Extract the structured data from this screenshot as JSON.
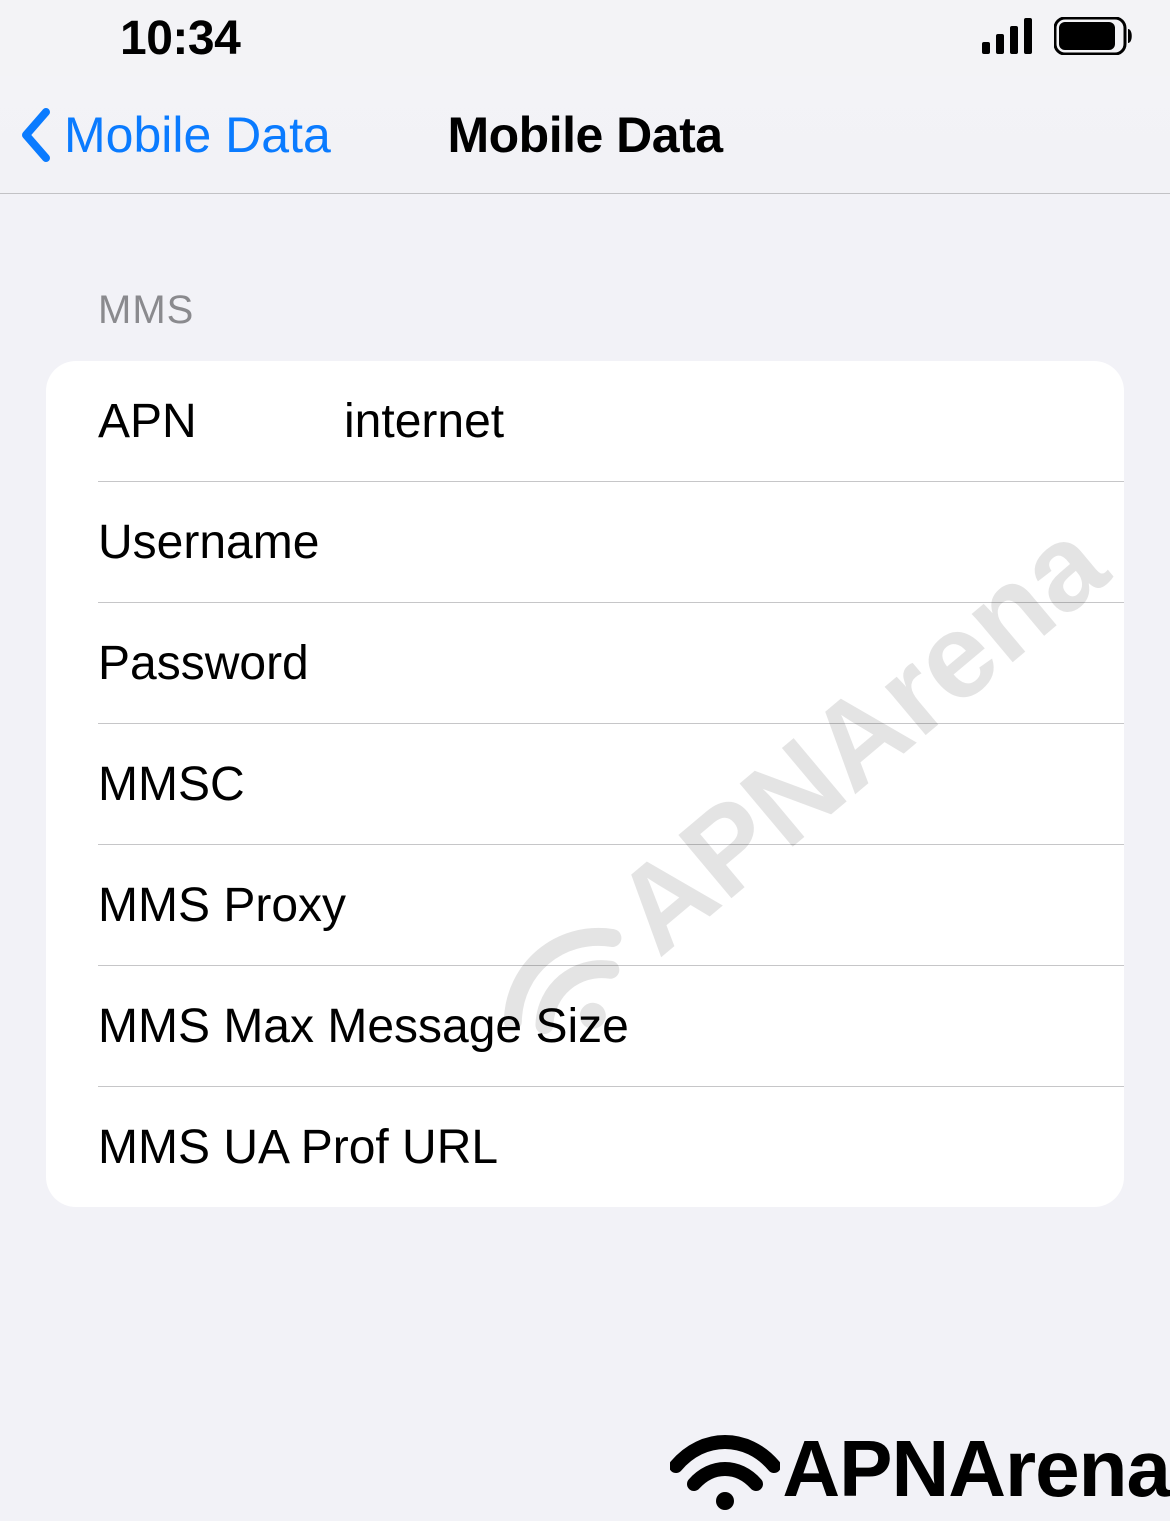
{
  "statusbar": {
    "time": "10:34"
  },
  "navbar": {
    "back_label": "Mobile Data",
    "title": "Mobile Data"
  },
  "section": {
    "header": "MMS"
  },
  "rows": {
    "apn": {
      "label": "APN",
      "value": "internet"
    },
    "username": {
      "label": "Username",
      "value": ""
    },
    "password": {
      "label": "Password",
      "value": ""
    },
    "mmsc": {
      "label": "MMSC",
      "value": ""
    },
    "mmsproxy": {
      "label": "MMS Proxy",
      "value": ""
    },
    "mmsmax": {
      "label": "MMS Max Message Size",
      "value": ""
    },
    "mmsua": {
      "label": "MMS UA Prof URL",
      "value": ""
    }
  },
  "watermark": {
    "text": "APNArena"
  },
  "logo": {
    "text": "APNArena"
  }
}
